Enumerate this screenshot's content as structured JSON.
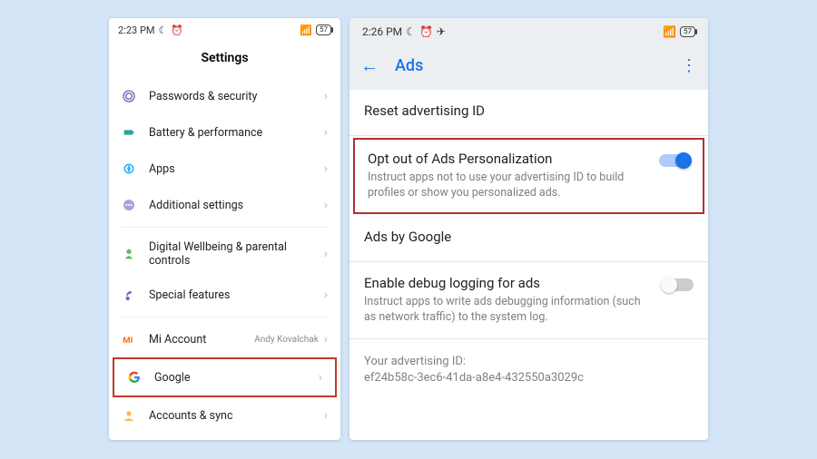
{
  "left": {
    "status": {
      "time": "2:23 PM",
      "battery": "57"
    },
    "title": "Settings",
    "items": [
      {
        "label": "Passwords & security",
        "icon": "fingerprint"
      },
      {
        "label": "Battery & performance",
        "icon": "battery"
      },
      {
        "label": "Apps",
        "icon": "apps"
      },
      {
        "label": "Additional settings",
        "icon": "dots"
      }
    ],
    "items2": [
      {
        "label": "Digital Wellbeing & parental controls",
        "icon": "wellbeing"
      },
      {
        "label": "Special features",
        "icon": "special"
      }
    ],
    "items3": [
      {
        "label": "Mi Account",
        "value": "Andy Kovalchak",
        "icon": "mi"
      },
      {
        "label": "Google",
        "icon": "google",
        "highlight": true
      },
      {
        "label": "Accounts & sync",
        "icon": "account"
      }
    ]
  },
  "right": {
    "status": {
      "time": "2:26 PM",
      "battery": "57"
    },
    "header": {
      "title": "Ads"
    },
    "items": [
      {
        "title": "Reset advertising ID"
      },
      {
        "title": "Opt out of Ads Personalization",
        "desc": "Instruct apps not to use your advertising ID to build profiles or show you personalized ads.",
        "toggle": "on",
        "highlight": true
      },
      {
        "title": "Ads by Google"
      },
      {
        "title": "Enable debug logging for ads",
        "desc": "Instruct apps to write ads debugging information (such as network traffic) to the system log.",
        "toggle": "off"
      }
    ],
    "footer": {
      "label": "Your advertising ID:",
      "id": "ef24b58c-3ec6-41da-a8e4-432550a3029c"
    }
  }
}
